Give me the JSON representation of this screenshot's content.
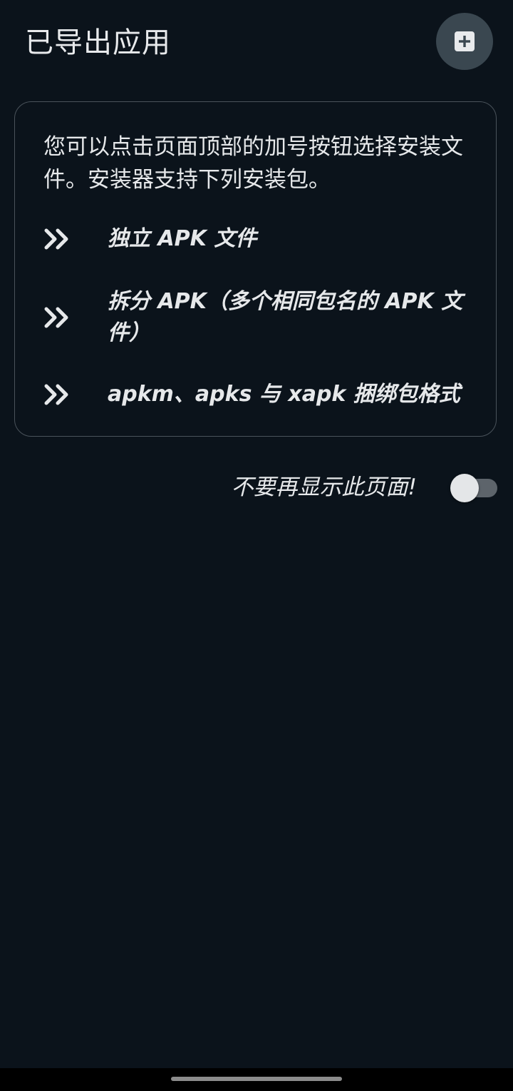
{
  "header": {
    "title": "已导出应用",
    "add_button_icon": "add-box-icon"
  },
  "info_card": {
    "intro": "您可以点击页面顶部的加号按钮选择安装文件。安装器支持下列安装包。",
    "bullet_icon": "double-chevron-right-icon",
    "formats": [
      {
        "label": "独立 APK 文件"
      },
      {
        "label": "拆分 APK（多个相同包名的 APK 文件）"
      },
      {
        "label": "apkm、apks 与 xapk 捆绑包格式"
      }
    ]
  },
  "dont_show": {
    "label": "不要再显示此页面!",
    "enabled": false
  },
  "colors": {
    "background": "#0b131b",
    "fab": "#3a4750",
    "card_border": "#4a535b",
    "text": "#e6e8ea"
  }
}
